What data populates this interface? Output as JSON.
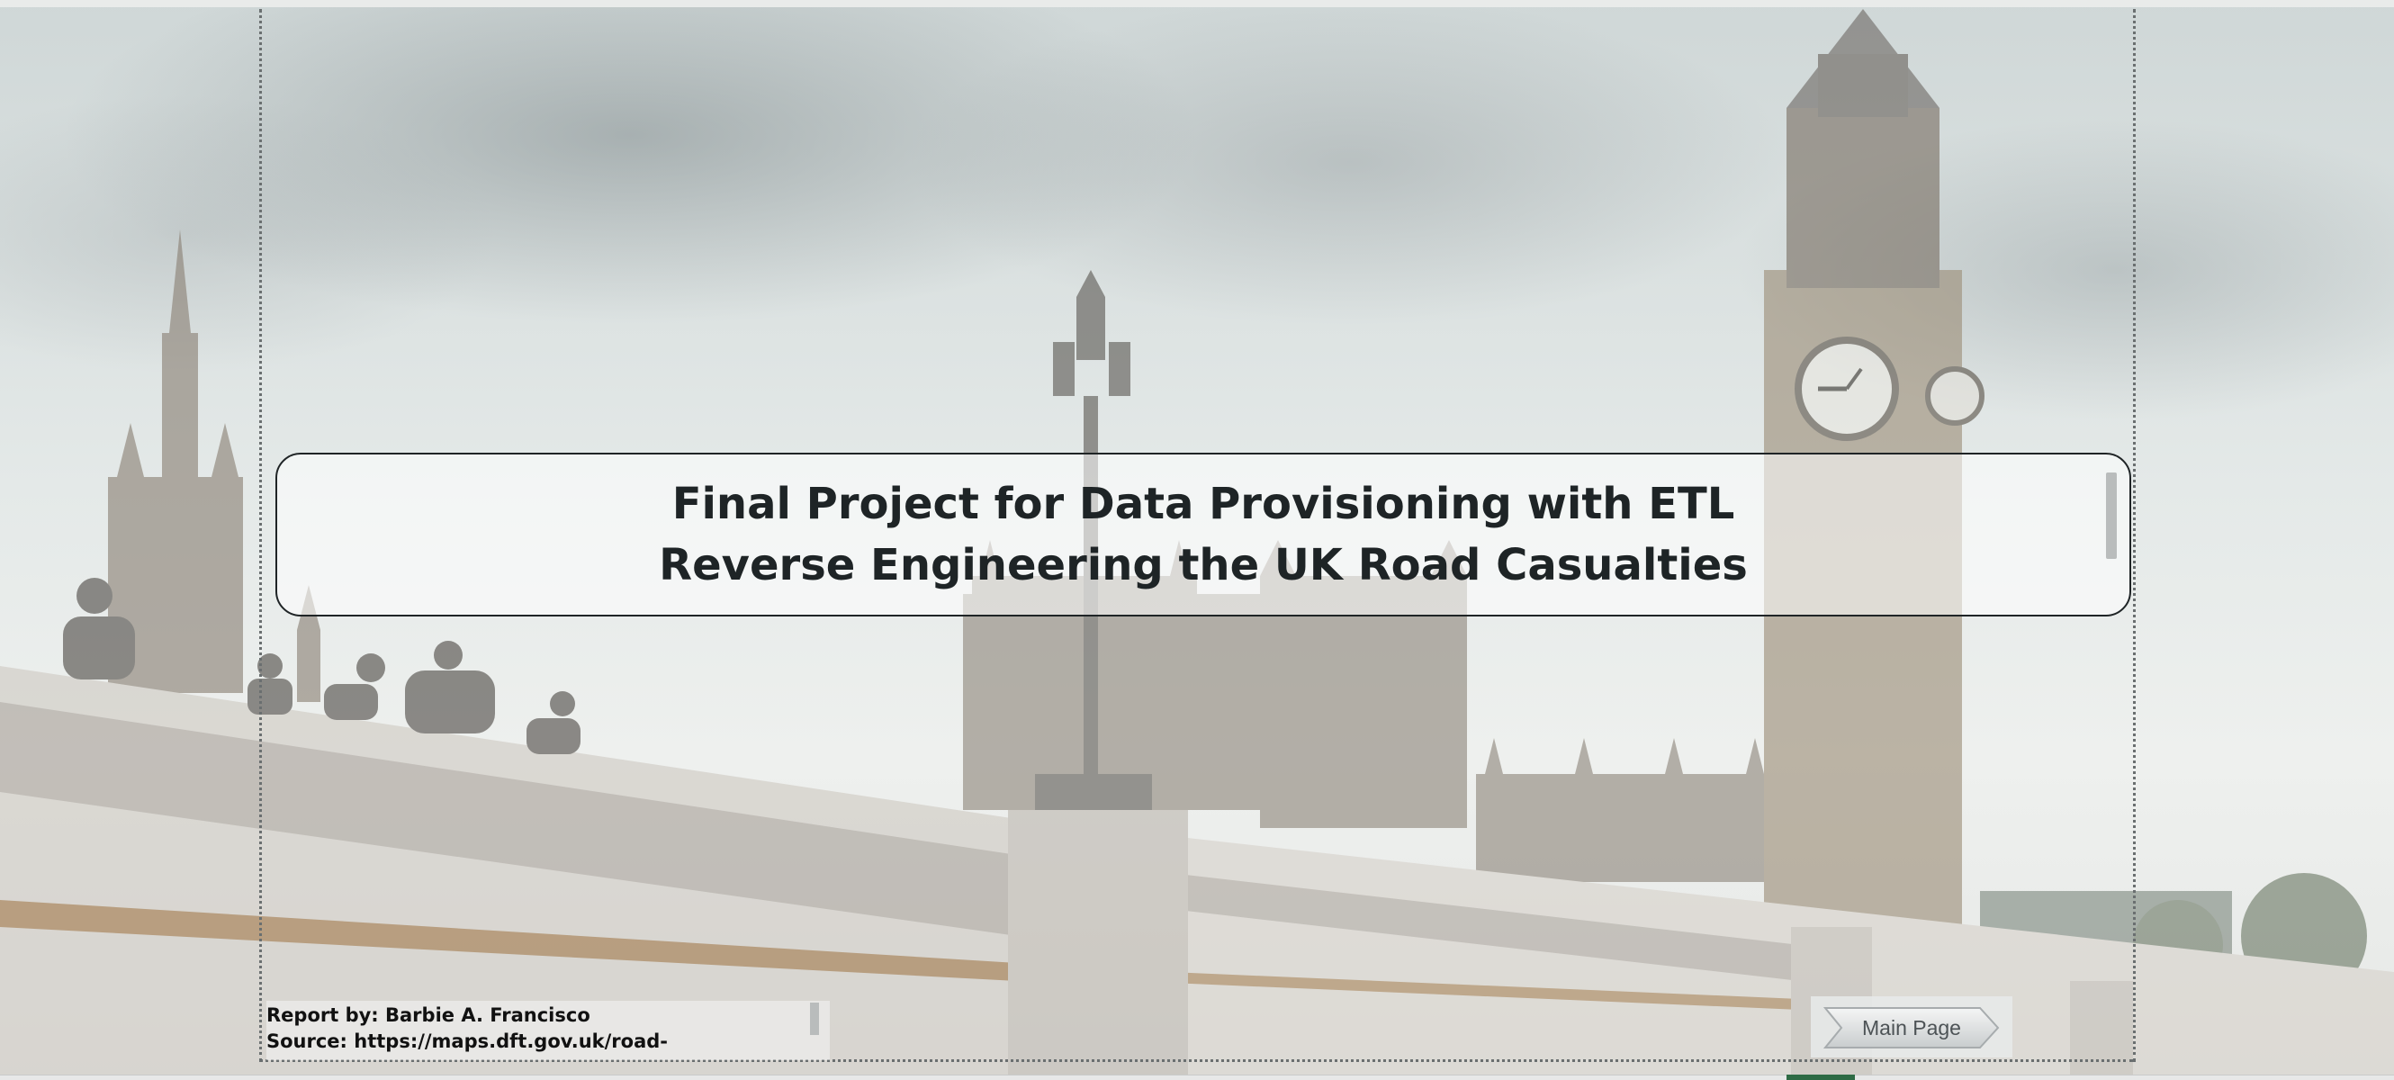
{
  "title": {
    "line1": "Final Project for Data Provisioning with ETL",
    "line2": "Reverse Engineering the UK Road Casualties"
  },
  "footer": {
    "report_by": "Report by: Barbie A. Francisco",
    "source": "Source: https://maps.dft.gov.uk/road-"
  },
  "navigation": {
    "main_page_label": "Main Page"
  },
  "colors": {
    "title_text": "#1e2426",
    "sheet_tab_active": "#2e6b45",
    "button_text": "#4d5356"
  },
  "background_image": "london-westminster-bridge-big-ben-photo"
}
